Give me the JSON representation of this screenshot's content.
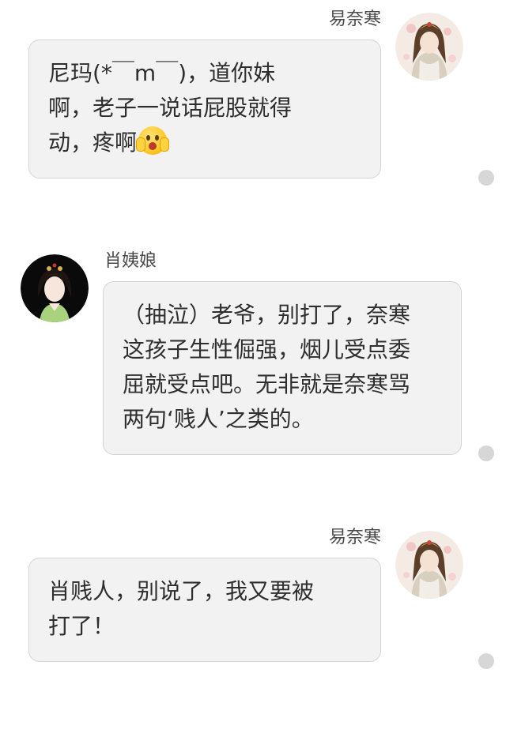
{
  "messages": [
    {
      "sender": "易奈寒",
      "side": "right",
      "lines": [
        "尼玛(*￣m￣)，道你妹",
        "啊，老子一说话屁股就得",
        "动，疼啊"
      ],
      "emoji": "scream-face-icon"
    },
    {
      "sender": "肖姨娘",
      "side": "left",
      "lines": [
        "（抽泣）老爷，别打了，奈寒",
        "这孩子生性倔强，烟儿受点委",
        "屈就受点吧。无非就是奈寒骂",
        "两句‘贱人’之类的。"
      ]
    },
    {
      "sender": "易奈寒",
      "side": "right",
      "lines": [
        "肖贱人，别说了，我又要被",
        "打了！"
      ]
    }
  ],
  "colors": {
    "bubble_bg": "#f2f2f2",
    "bubble_border": "#d4d4d4",
    "status_dot": "#d7d7d7"
  }
}
